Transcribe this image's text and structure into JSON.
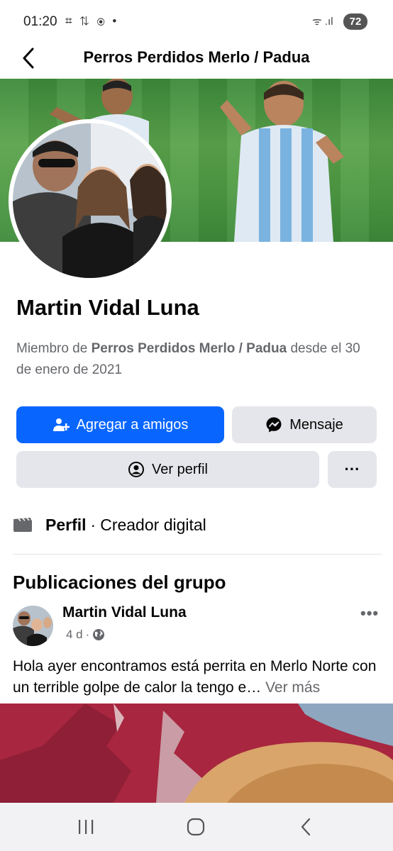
{
  "status_bar": {
    "time": "01:20",
    "left_icons": "⌗ ⇅ ⦿ •",
    "right_icons": "ᯤ .ıl",
    "battery": "72"
  },
  "header": {
    "title": "Perros Perdidos Merlo / Padua"
  },
  "profile": {
    "name": "Martin Vidal Luna",
    "member_prefix": "Miembro de ",
    "group_name": "Perros Perdidos Merlo / Padua",
    "member_suffix": " desde el 30 de enero de 2021"
  },
  "actions": {
    "add_friend": "Agregar a amigos",
    "message": "Mensaje",
    "view_profile": "Ver perfil",
    "more": "···"
  },
  "role": {
    "label": "Perfil",
    "separator": "·",
    "value": "Creador digital"
  },
  "group_posts": {
    "title": "Publicaciones del grupo",
    "post": {
      "author": "Martin Vidal Luna",
      "time": "4 d",
      "dot": "·",
      "text": "Hola ayer encontramos está perrita en Merlo Norte con un terrible golpe de calor la tengo e…",
      "see_more": " Ver más",
      "more": "•••"
    }
  },
  "colors": {
    "accent": "#0866ff",
    "secondary_button": "#e4e6eb",
    "muted_text": "#65676b"
  }
}
